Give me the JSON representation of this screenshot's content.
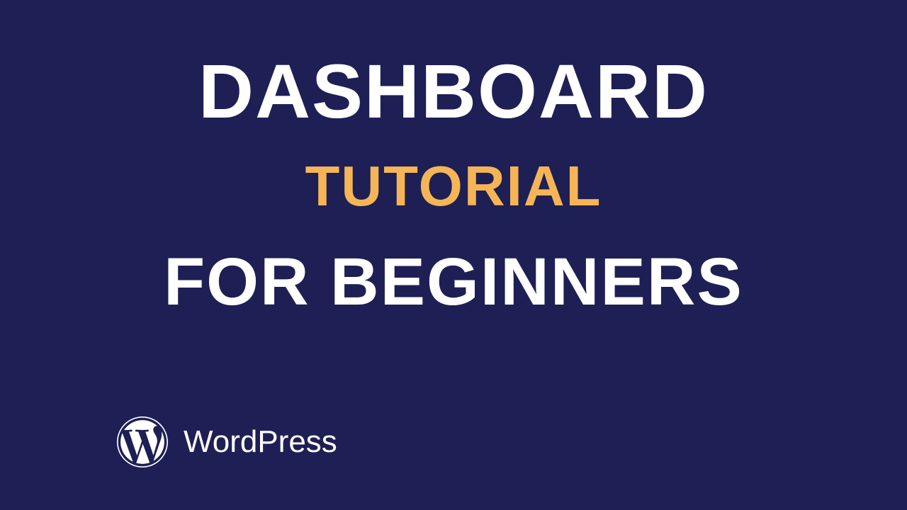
{
  "title": {
    "line1": "DASHBOARD",
    "line2": "TUTORIAL",
    "line3": "FOR BEGINNERS"
  },
  "logo": {
    "label": "WordPress",
    "icon": "wordpress-icon"
  },
  "colors": {
    "background": "#1e1f54",
    "primary_text": "#ffffff",
    "accent_text": "#f5b557"
  }
}
